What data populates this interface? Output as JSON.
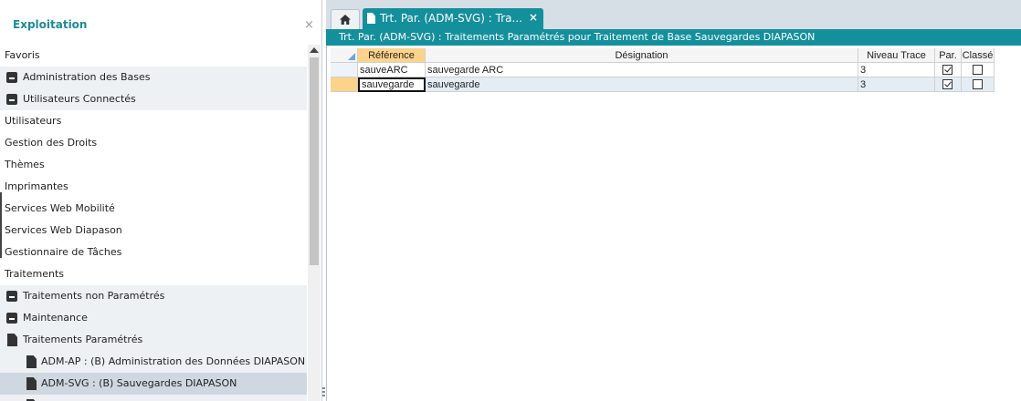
{
  "sidebar": {
    "title": "Exploitation",
    "close": "×",
    "items": [
      {
        "label": "Favoris",
        "kind": "plain"
      },
      {
        "label": "Administration des Bases",
        "kind": "group"
      },
      {
        "label": "Utilisateurs Connectés",
        "kind": "group"
      },
      {
        "label": "Utilisateurs",
        "kind": "plain"
      },
      {
        "label": "Gestion des Droits",
        "kind": "plain"
      },
      {
        "label": "Thèmes",
        "kind": "plain"
      },
      {
        "label": "Imprimantes",
        "kind": "plain"
      },
      {
        "label": "Services Web Mobilité",
        "kind": "plain"
      },
      {
        "label": "Services Web Diapason",
        "kind": "plain"
      },
      {
        "label": "Gestionnaire de Tâches",
        "kind": "plain"
      },
      {
        "label": "Traitements",
        "kind": "plain"
      },
      {
        "label": "Traitements non Paramétrés",
        "kind": "group"
      },
      {
        "label": "Maintenance",
        "kind": "group"
      },
      {
        "label": "Traitements Paramétrés",
        "kind": "doc"
      },
      {
        "label": "ADM-AP : (B) Administration des Données DIAPASON",
        "kind": "subdoc"
      },
      {
        "label": "ADM-SVG : (B) Sauvegardes DIAPASON",
        "kind": "subdoc-selected"
      }
    ]
  },
  "tabs": {
    "active_label": "Trt. Par. (ADM-SVG) : Tra...",
    "close": "×"
  },
  "window_title": "Trt. Par. (ADM-SVG) : Traitements Paramétrés pour Traitement de Base Sauvegardes DIAPASON",
  "grid": {
    "columns": [
      "Référence",
      "Désignation",
      "Niveau Trace",
      "Par.",
      "Classé"
    ],
    "rows": [
      {
        "reference": "sauveARC",
        "designation": "sauvegarde ARC",
        "niveau_trace": "3",
        "par": true,
        "classe": false
      },
      {
        "reference": "sauvegarde",
        "designation": "sauvegarde",
        "niveau_trace": "3",
        "par": true,
        "classe": false
      }
    ]
  }
}
